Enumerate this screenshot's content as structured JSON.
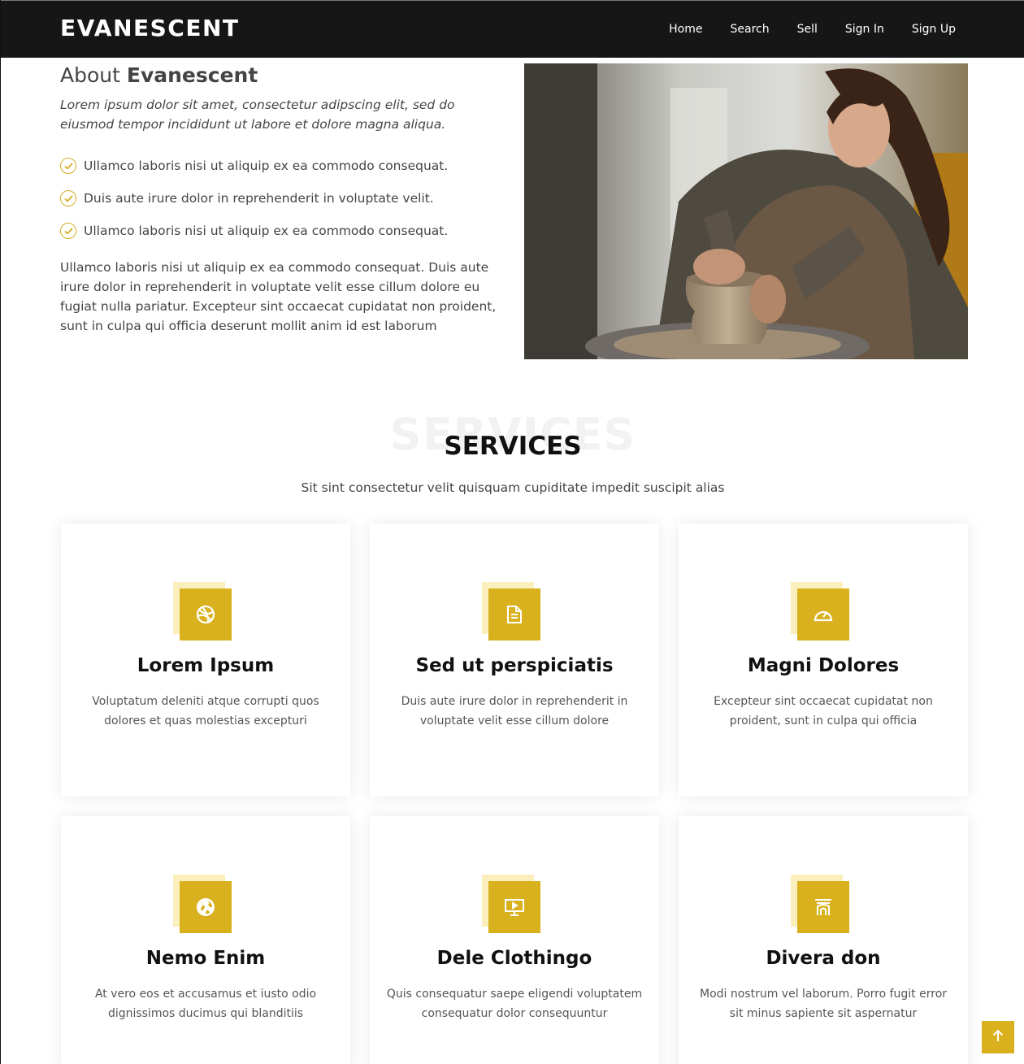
{
  "header": {
    "logo": "EVANESCENT",
    "nav": [
      "Home",
      "Search",
      "Sell",
      "Sign In",
      "Sign Up"
    ]
  },
  "about": {
    "title_prefix": "About",
    "title_brand": "Evanescent",
    "lead": "Lorem ipsum dolor sit amet, consectetur adipscing elit, sed do eiusmod tempor incididunt ut labore et dolore magna aliqua.",
    "checklist": [
      "Ullamco laboris nisi ut aliquip ex ea commodo consequat.",
      "Duis aute irure dolor in reprehenderit in voluptate velit.",
      "Ullamco laboris nisi ut aliquip ex ea commodo consequat."
    ],
    "paragraph": "Ullamco laboris nisi ut aliquip ex ea commodo consequat. Duis aute irure dolor in reprehenderit in voluptate velit esse cillum dolore eu fugiat nulla pariatur. Excepteur sint occaecat cupidatat non proident, sunt in culpa qui officia deserunt mollit anim id est laborum"
  },
  "services": {
    "background_word": "SERVICES",
    "title": "SERVICES",
    "subtitle": "Sit sint consectetur velit quisquam cupiditate impedit suscipit alias",
    "cards": [
      {
        "icon": "dribbble-icon",
        "title": "Lorem Ipsum",
        "text": "Voluptatum deleniti atque corrupti quos dolores et quas molestias excepturi"
      },
      {
        "icon": "file-text-icon",
        "title": "Sed ut perspiciatis",
        "text": "Duis aute irure dolor in reprehenderit in voluptate velit esse cillum dolore"
      },
      {
        "icon": "speedometer-icon",
        "title": "Magni Dolores",
        "text": "Excepteur sint occaecat cupidatat non proident, sunt in culpa qui officia"
      },
      {
        "icon": "globe-icon",
        "title": "Nemo Enim",
        "text": "At vero eos et accusamus et iusto odio dignissimos ducimus qui blanditiis"
      },
      {
        "icon": "slideshow-icon",
        "title": "Dele Clothingo",
        "text": "Quis consequatur saepe eligendi voluptatem consequatur dolor consequuntur"
      },
      {
        "icon": "arch-icon",
        "title": "Divera don",
        "text": "Modi nostrum vel laborum. Porro fugit error sit minus sapiente sit aspernatur"
      }
    ]
  },
  "colors": {
    "accent": "#d9b11f",
    "accent_light": "#fbefbe",
    "header_bg": "#161616"
  },
  "back_to_top": {
    "icon": "arrow-up-icon"
  }
}
